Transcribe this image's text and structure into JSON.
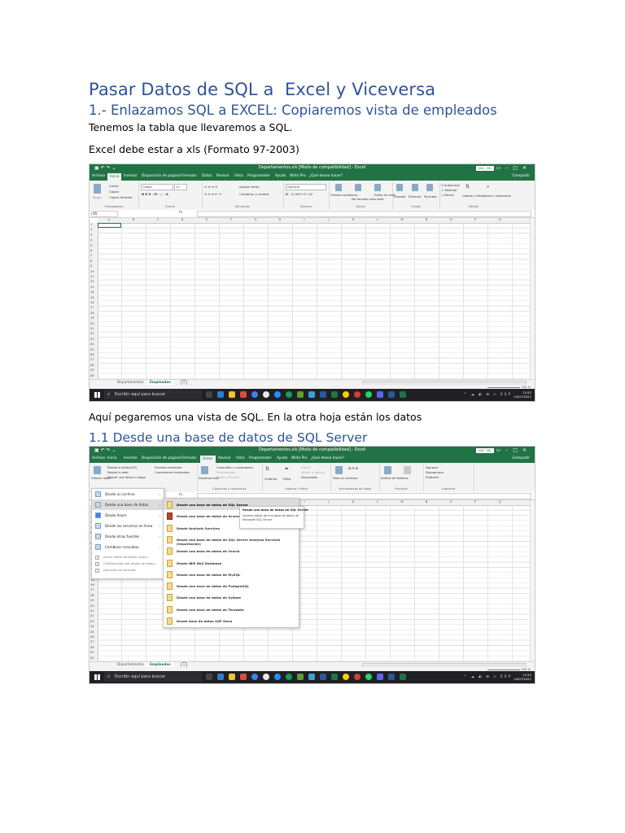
{
  "document": {
    "title": "Pasar Datos de SQL a  Excel y Viceversa",
    "heading1": "1.- Enlazamos SQL a EXCEL: Copiaremos vista de empleados",
    "para1": "Tenemos la tabla que llevaremos a SQL.",
    "para2": "Excel debe estar a xls (Formato 97-2003)",
    "para3": "Aquí pegaremos una vista de SQL. En la otra hoja están los datos",
    "heading2": "1.1 Desde una base de datos de SQL Server"
  },
  "excel": {
    "window_title": "Departamentos.xls  [Modo de compatibilidad]  -  Excel",
    "user_badge": "IVAC. SKL",
    "tabs": [
      "Archivo",
      "Inicio",
      "Insertar",
      "Disposición de página",
      "Fórmulas",
      "Datos",
      "Revisar",
      "Vista",
      "Programador",
      "Ayuda",
      "Write Pro",
      "¿Qué desea hacer?"
    ],
    "share": "Compartir",
    "name_box": "A5",
    "fx": "fx",
    "columns": [
      "A",
      "B",
      "C",
      "D",
      "E",
      "F",
      "G",
      "H",
      "I",
      "J",
      "K",
      "L",
      "M",
      "N",
      "O",
      "P",
      "Q"
    ],
    "rows": [
      "1",
      "2",
      "3",
      "4",
      "5",
      "6",
      "7",
      "8",
      "9",
      "10",
      "11",
      "12",
      "13",
      "14",
      "15",
      "16",
      "17",
      "18",
      "19",
      "20",
      "21",
      "22",
      "23",
      "24",
      "25",
      "26",
      "27",
      "28",
      "29",
      "30"
    ],
    "sheets": [
      "Departamentos",
      "Empleados"
    ],
    "active_sheet": "Empleados",
    "zoom": "100 %",
    "taskbar_search": "Escribir aquí para buscar",
    "tray": "^ ☁ ◐ ⊞ ☉ ESP",
    "screenshot1": {
      "ribbon": {
        "clipboard": {
          "paste": "Pegar",
          "cut": "Cortar",
          "copy": "Copiar",
          "format": "Copiar formato",
          "group": "Portapapeles"
        },
        "font": {
          "name": "Calibri",
          "size": "11",
          "group": "Fuente"
        },
        "alignment": {
          "wrap": "Ajustar texto",
          "merge": "Combinar y centrar",
          "group": "Alineación"
        },
        "number": {
          "format": "General",
          "group": "Número"
        },
        "styles": {
          "cond": "Formato condicional",
          "table": "Dar formato como tabla",
          "cell": "Estilos de celda",
          "group": "Estilos"
        },
        "cells": {
          "insert": "Insertar",
          "delete": "Eliminar",
          "format": "Formato",
          "group": "Celdas"
        },
        "editing": {
          "autosum": "Autosuma",
          "fill": "Rellenar",
          "clear": "Borrar",
          "sort": "Ordenar y filtrar",
          "find": "Buscar y seleccionar",
          "group": "Edición"
        }
      },
      "time": "12:52",
      "date": "14/07/2021"
    },
    "screenshot2": {
      "ribbon": {
        "get": {
          "btn": "Obtener datos",
          "from_text": "Desde el texto/CSV",
          "from_web": "Desde la web",
          "from_table": "Desde una tabla o rango",
          "recent": "Fuentes recientes",
          "existing": "Conexiones existentes"
        },
        "queries": {
          "refresh": "Actualizar todo",
          "conn": "Consultas y conexiones",
          "props": "Propiedades",
          "edit": "Editar vínculos",
          "group": "Consultas y conexiones"
        },
        "sort": {
          "sort": "Ordenar",
          "filter": "Filtro",
          "clear": "Borrar",
          "reapply": "Volver a aplicar",
          "adv": "Avanzadas",
          "group": "Ordenar y filtrar"
        },
        "tools": {
          "text": "Texto en columnas",
          "group": "Herramientas de datos"
        },
        "forecast": {
          "whatif": "Análisis de hipótesis",
          "sheet": "Previsión",
          "group": "Previsión"
        },
        "outline": {
          "group_btn": "Agrupar",
          "ungroup": "Desagrupar",
          "subtotal": "Subtotal",
          "group": "Esquema"
        }
      },
      "menu1": [
        {
          "label": "Desde un archivo",
          "arrow": "›"
        },
        {
          "label": "Desde una base de datos",
          "arrow": "›"
        },
        {
          "label": "Desde Azure",
          "arrow": "›"
        },
        {
          "label": "Desde los servicios en línea",
          "arrow": "›"
        },
        {
          "label": "Desde otras fuentes",
          "arrow": "›"
        },
        {
          "label": "Combinar consultas",
          "arrow": "›"
        }
      ],
      "menu1_small": [
        "Iniciar Editor de Power Query...",
        "Configuración del origen de datos...",
        "Opciones de consulta"
      ],
      "menu2": [
        "Desde una base de datos de SQL Server",
        "Desde una base de datos de Access",
        "Desde Analysis Services",
        "Desde una base de datos de SQL Server Analysis Services (importación)",
        "Desde una base de datos de Oracle",
        "Desde IBM Db2 Database",
        "Desde una base de datos de MySQL",
        "Desde una base de datos de PostgreSQL",
        "Desde una base de datos de Sybase",
        "Desde una base de datos de Teradata",
        "Desde base de datos SAP Hana"
      ],
      "tooltip": {
        "title": "Desde una base de datos de SQL Server",
        "desc": "Importe datos de una base de datos de Microsoft SQL Server."
      },
      "time": "12:54",
      "date": "14/07/2021"
    }
  }
}
